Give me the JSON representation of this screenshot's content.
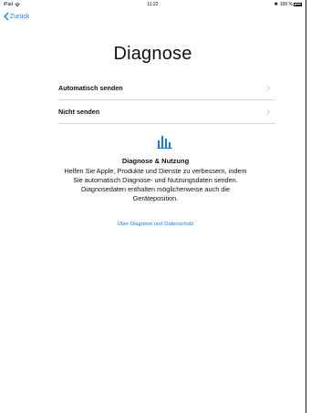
{
  "status_bar": {
    "device": "iPad",
    "time": "11:22",
    "battery": "100 %"
  },
  "nav": {
    "back_label": "Zurück"
  },
  "page": {
    "title": "Diagnose"
  },
  "options": [
    {
      "label": "Automatisch senden"
    },
    {
      "label": "Nicht senden"
    }
  ],
  "section": {
    "heading": "Diagnose & Nutzung",
    "body": "Helfen Sie Apple, Produkte und Dienste zu verbessern, indem Sie automatisch Diagnose- und Nutzungsdaten senden. Diagnosedaten enthalten möglicherweise auch die Geräteposition.",
    "link": "Über Diagnose und Datenschutz"
  },
  "colors": {
    "accent": "#0a7aff",
    "divider": "#d8d8dc"
  },
  "icons": [
    "wifi-icon",
    "bluetooth-icon",
    "battery-icon",
    "chevron-left-icon",
    "chevron-right-icon",
    "bar-chart-icon"
  ]
}
